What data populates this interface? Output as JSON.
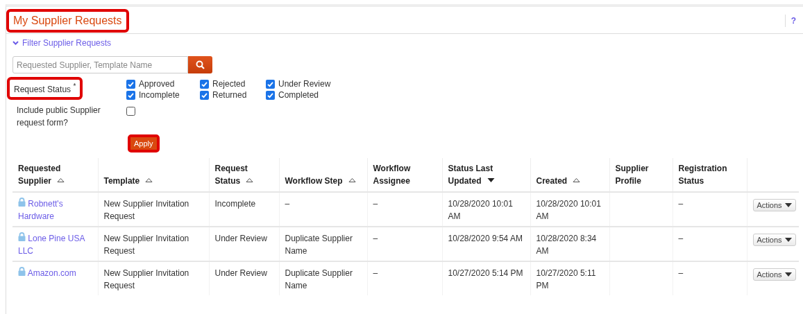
{
  "page": {
    "title": "My Supplier Requests",
    "title_highlighted": true,
    "help": "?"
  },
  "filter": {
    "label": "Filter Supplier Requests",
    "expanded": true,
    "search": {
      "placeholder": "Requested Supplier, Template Name"
    },
    "status_label": "Request Status",
    "required_mark": "*",
    "status_highlighted": true,
    "statuses": [
      {
        "label": "Approved",
        "checked": true
      },
      {
        "label": "Rejected",
        "checked": true
      },
      {
        "label": "Under Review",
        "checked": true
      },
      {
        "label": "Incomplete",
        "checked": true
      },
      {
        "label": "Returned",
        "checked": true
      },
      {
        "label": "Completed",
        "checked": true
      }
    ],
    "public_label": "Include public Supplier request form?",
    "public_checked": false,
    "apply": "Apply",
    "apply_highlighted": true
  },
  "table": {
    "columns": [
      {
        "label": "Requested Supplier",
        "sortable": true,
        "sorted": false
      },
      {
        "label": "Template",
        "sortable": true,
        "sorted": false
      },
      {
        "label": "Request Status",
        "sortable": true,
        "sorted": false
      },
      {
        "label": "Workflow Step",
        "sortable": true,
        "sorted": false
      },
      {
        "label": "Workflow Assignee",
        "sortable": false
      },
      {
        "label": "Status Last Updated",
        "sortable": true,
        "sorted": true
      },
      {
        "label": "Created",
        "sortable": true,
        "sorted": false
      },
      {
        "label": "Supplier Profile",
        "sortable": false
      },
      {
        "label": "Registration Status",
        "sortable": false
      }
    ],
    "rows": [
      {
        "supplier": "Robnett's Hardware",
        "template": "New Supplier Invitation Request",
        "request_status": "Incomplete",
        "workflow_step": "–",
        "workflow_assignee": "–",
        "status_last_updated": "10/28/2020 10:01 AM",
        "created": "10/28/2020 10:01 AM",
        "registration_status": "–",
        "action": "Actions"
      },
      {
        "supplier": "Lone Pine USA LLC",
        "template": "New Supplier Invitation Request",
        "request_status": "Under Review",
        "workflow_step": "Duplicate Supplier Name",
        "workflow_assignee": "–",
        "status_last_updated": "10/28/2020 9:54 AM",
        "created": "10/28/2020 8:34 AM",
        "registration_status": "–",
        "action": "Actions"
      },
      {
        "supplier": "Amazon.com",
        "template": "New Supplier Invitation Request",
        "request_status": "Under Review",
        "workflow_step": "Duplicate Supplier Name",
        "workflow_assignee": "–",
        "status_last_updated": "10/27/2020 5:14 PM",
        "created": "10/27/2020 5:11 PM",
        "registration_status": "–",
        "action": "Actions"
      }
    ]
  }
}
